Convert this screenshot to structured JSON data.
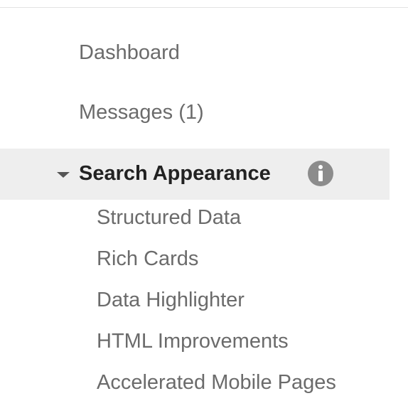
{
  "nav": {
    "items": [
      {
        "label": "Dashboard"
      },
      {
        "label": "Messages (1)"
      }
    ],
    "section": {
      "title": "Search Appearance",
      "info_icon": "info-icon",
      "expanded": true,
      "sub_items": [
        {
          "label": "Structured Data"
        },
        {
          "label": "Rich Cards"
        },
        {
          "label": "Data Highlighter"
        },
        {
          "label": "HTML Improvements"
        },
        {
          "label": "Accelerated Mobile Pages"
        }
      ]
    }
  },
  "colors": {
    "text_muted": "#6b6b6b",
    "text_strong": "#222222",
    "section_bg": "#eeeeee",
    "icon_gray": "#8c8c8c"
  }
}
